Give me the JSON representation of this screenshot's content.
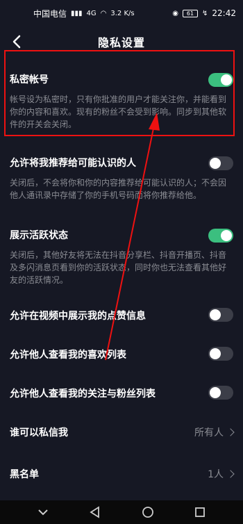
{
  "status": {
    "carrier": "中国电信",
    "network": "4G",
    "speed": "3.2 K/s",
    "battery": "61",
    "time": "22:42"
  },
  "header": {
    "title": "隐私设置"
  },
  "settings": [
    {
      "title": "私密帐号",
      "desc": "帐号设为私密时，只有你批准的用户才能关注你，并能看到你的内容和喜欢。现有的粉丝不会受到影响。同步到其他软件的开关会关闭。",
      "toggle": "on"
    },
    {
      "title": "允许将我推荐给可能认识的人",
      "desc": "关闭后，不会将你和你的内容推荐给可能认识的人；不会因他人通讯录中存储了你的手机号码而将你推荐给他。",
      "toggle": "off"
    },
    {
      "title": "展示活跃状态",
      "desc": "关闭后，其他好友将无法在抖音分享栏、抖音开播页、抖音及多闪消息页看到你的活跃状态，同时你也无法查看其他好友的活跃情况。",
      "toggle": "on"
    },
    {
      "title": "允许在视频中展示我的点赞信息",
      "toggle": "off"
    },
    {
      "title": "允许他人查看我的喜欢列表",
      "toggle": "off"
    },
    {
      "title": "允许他人查看我的关注与粉丝列表",
      "toggle": "off"
    },
    {
      "title": "谁可以私信我",
      "value": "所有人"
    },
    {
      "title": "黑名单",
      "value": "1人"
    }
  ],
  "colors": {
    "accent": "#3bbf7f",
    "highlight": "#ee1111",
    "background": "#161824"
  },
  "icons": [
    "back-arrow-icon",
    "nav-back-icon",
    "home-icon",
    "recents-icon",
    "keyboard-hide-icon"
  ]
}
